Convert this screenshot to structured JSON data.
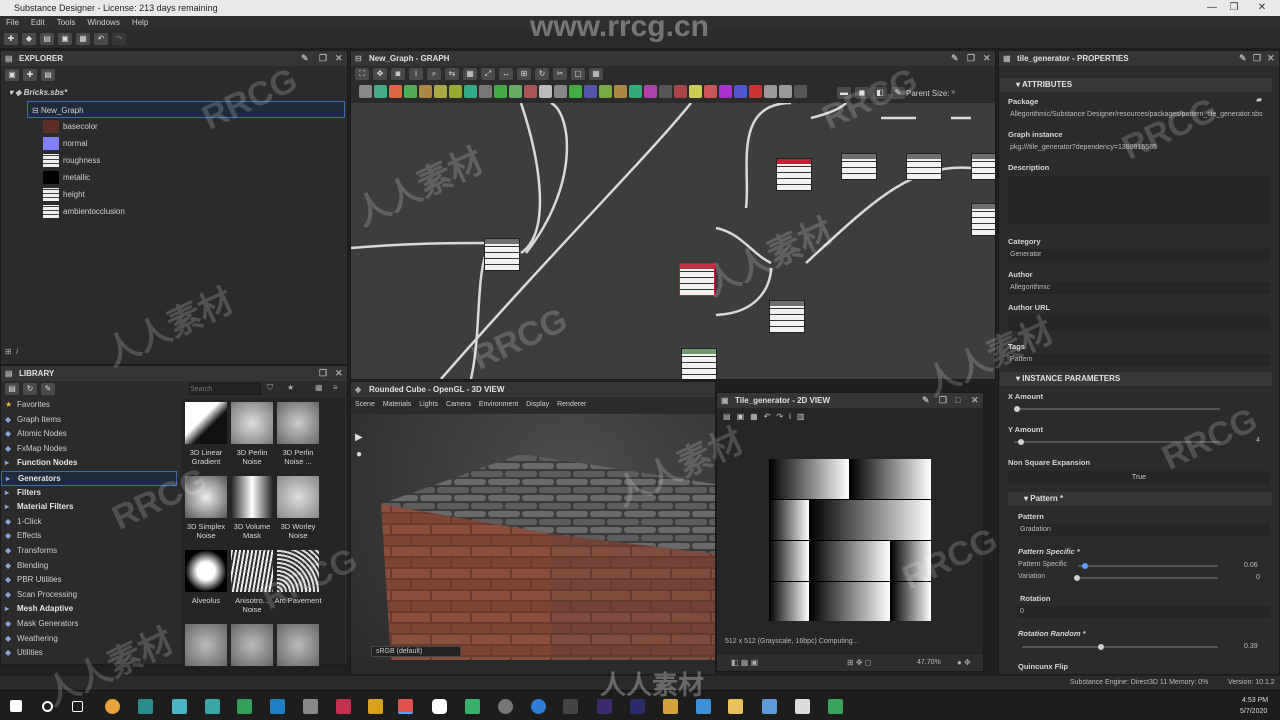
{
  "app": {
    "title": "Substance Designer - License: 213 days remaining"
  },
  "window_controls": {
    "minimize": "—",
    "maximize": "❐",
    "close": "✕"
  },
  "menu": [
    "File",
    "Edit",
    "Tools",
    "Windows",
    "Help"
  ],
  "explorer": {
    "title": "EXPLORER",
    "package": "Bricks.sbs*",
    "graph": "New_Graph",
    "outputs": [
      {
        "label": "basecolor",
        "color": "#5b2f24"
      },
      {
        "label": "normal",
        "color": "#7f7fff"
      },
      {
        "label": "roughness",
        "color": "bricks"
      },
      {
        "label": "metallic",
        "color": "#000000"
      },
      {
        "label": "height",
        "color": "bricks"
      },
      {
        "label": "ambientocclusion",
        "color": "bricks"
      }
    ]
  },
  "library": {
    "title": "LIBRARY",
    "search_placeholder": "Search",
    "categories": [
      {
        "label": "Favorites",
        "sec": false
      },
      {
        "label": "Graph Items",
        "sec": false
      },
      {
        "label": "Atomic Nodes",
        "sec": false
      },
      {
        "label": "FxMap Nodes",
        "sec": false
      },
      {
        "label": "Function Nodes",
        "sec": true
      },
      {
        "label": "Generators",
        "sec": true
      },
      {
        "label": "Filters",
        "sec": true
      },
      {
        "label": "Material Filters",
        "sec": true
      },
      {
        "label": "1-Click",
        "sec": false
      },
      {
        "label": "Effects",
        "sec": false
      },
      {
        "label": "Transforms",
        "sec": false
      },
      {
        "label": "Blending",
        "sec": false
      },
      {
        "label": "PBR Utilities",
        "sec": false
      },
      {
        "label": "Scan Processing",
        "sec": false
      },
      {
        "label": "Mesh Adaptive",
        "sec": true
      },
      {
        "label": "Mask Generators",
        "sec": false
      },
      {
        "label": "Weathering",
        "sec": false
      },
      {
        "label": "Utilities",
        "sec": false
      }
    ],
    "items": [
      {
        "label": "3D Linear Gradient"
      },
      {
        "label": "3D Perlin Noise"
      },
      {
        "label": "3D Perlin Noise ..."
      },
      {
        "label": "3D Simplex Noise"
      },
      {
        "label": "3D Volume Mask"
      },
      {
        "label": "3D Worley Noise"
      },
      {
        "label": "Alveolus"
      },
      {
        "label": "Anisotro... Noise"
      },
      {
        "label": "Arc Pavement"
      }
    ]
  },
  "graph": {
    "title": "New_Graph - GRAPH",
    "parent_size_label": "Parent Size:"
  },
  "view3d": {
    "title": "Rounded Cube - OpenGL - 3D VIEW",
    "menu": [
      "Scene",
      "Materials",
      "Lights",
      "Camera",
      "Environment",
      "Display",
      "Renderer"
    ],
    "colorspace": "sRGB (default)"
  },
  "view2d": {
    "title": "Tile_generator - 2D VIEW",
    "status": "512 x 512 (Grayscale, 16bpc) Computing...",
    "zoom": "47.70%"
  },
  "properties": {
    "title": "tile_generator - PROPERTIES",
    "attributes_header": "ATTRIBUTES",
    "package_label": "Package",
    "package_value": "Allegorithmic/Substance Designer/resources/packages/pattern_tile_generator.sbs",
    "graph_instance_label": "Graph instance",
    "graph_instance_value": "pkg:///tile_generator?dependency=1380916585",
    "description_label": "Description",
    "category_label": "Category",
    "category_value": "Generator",
    "author_label": "Author",
    "author_value": "Allegorithmic",
    "author_url_label": "Author URL",
    "tags_label": "Tags",
    "tags_value": "Pattern",
    "instance_header": "INSTANCE PARAMETERS",
    "x_amount_label": "X Amount",
    "y_amount_label": "Y Amount",
    "y_amount_value": "4",
    "non_square_label": "Non Square Expansion",
    "non_square_value": "True",
    "pattern_header": "Pattern *",
    "pattern_label": "Pattern",
    "pattern_value": "Gradation",
    "pattern_specific_header": "Pattern Specific *",
    "pattern_specific_label": "Pattern Specific",
    "pattern_specific_value": "0.06",
    "variation_label": "Variation",
    "variation_value": "0",
    "rotation_label": "Rotation",
    "rotation_value": "0",
    "rotation_random_label": "Rotation Random *",
    "rotation_random_value": "0.39",
    "quincunx_label": "Quincunx Flip"
  },
  "statusbar": {
    "engine": "Substance Engine: Direct3D 11  Memory: 0%",
    "version": "Version: 10.1.2"
  },
  "taskbar": {
    "time": "4:53 PM",
    "date": "5/7/2020"
  },
  "watermark": {
    "site": "www.rrcg.cn",
    "brand": "RRCG",
    "cn": "人人素材"
  }
}
